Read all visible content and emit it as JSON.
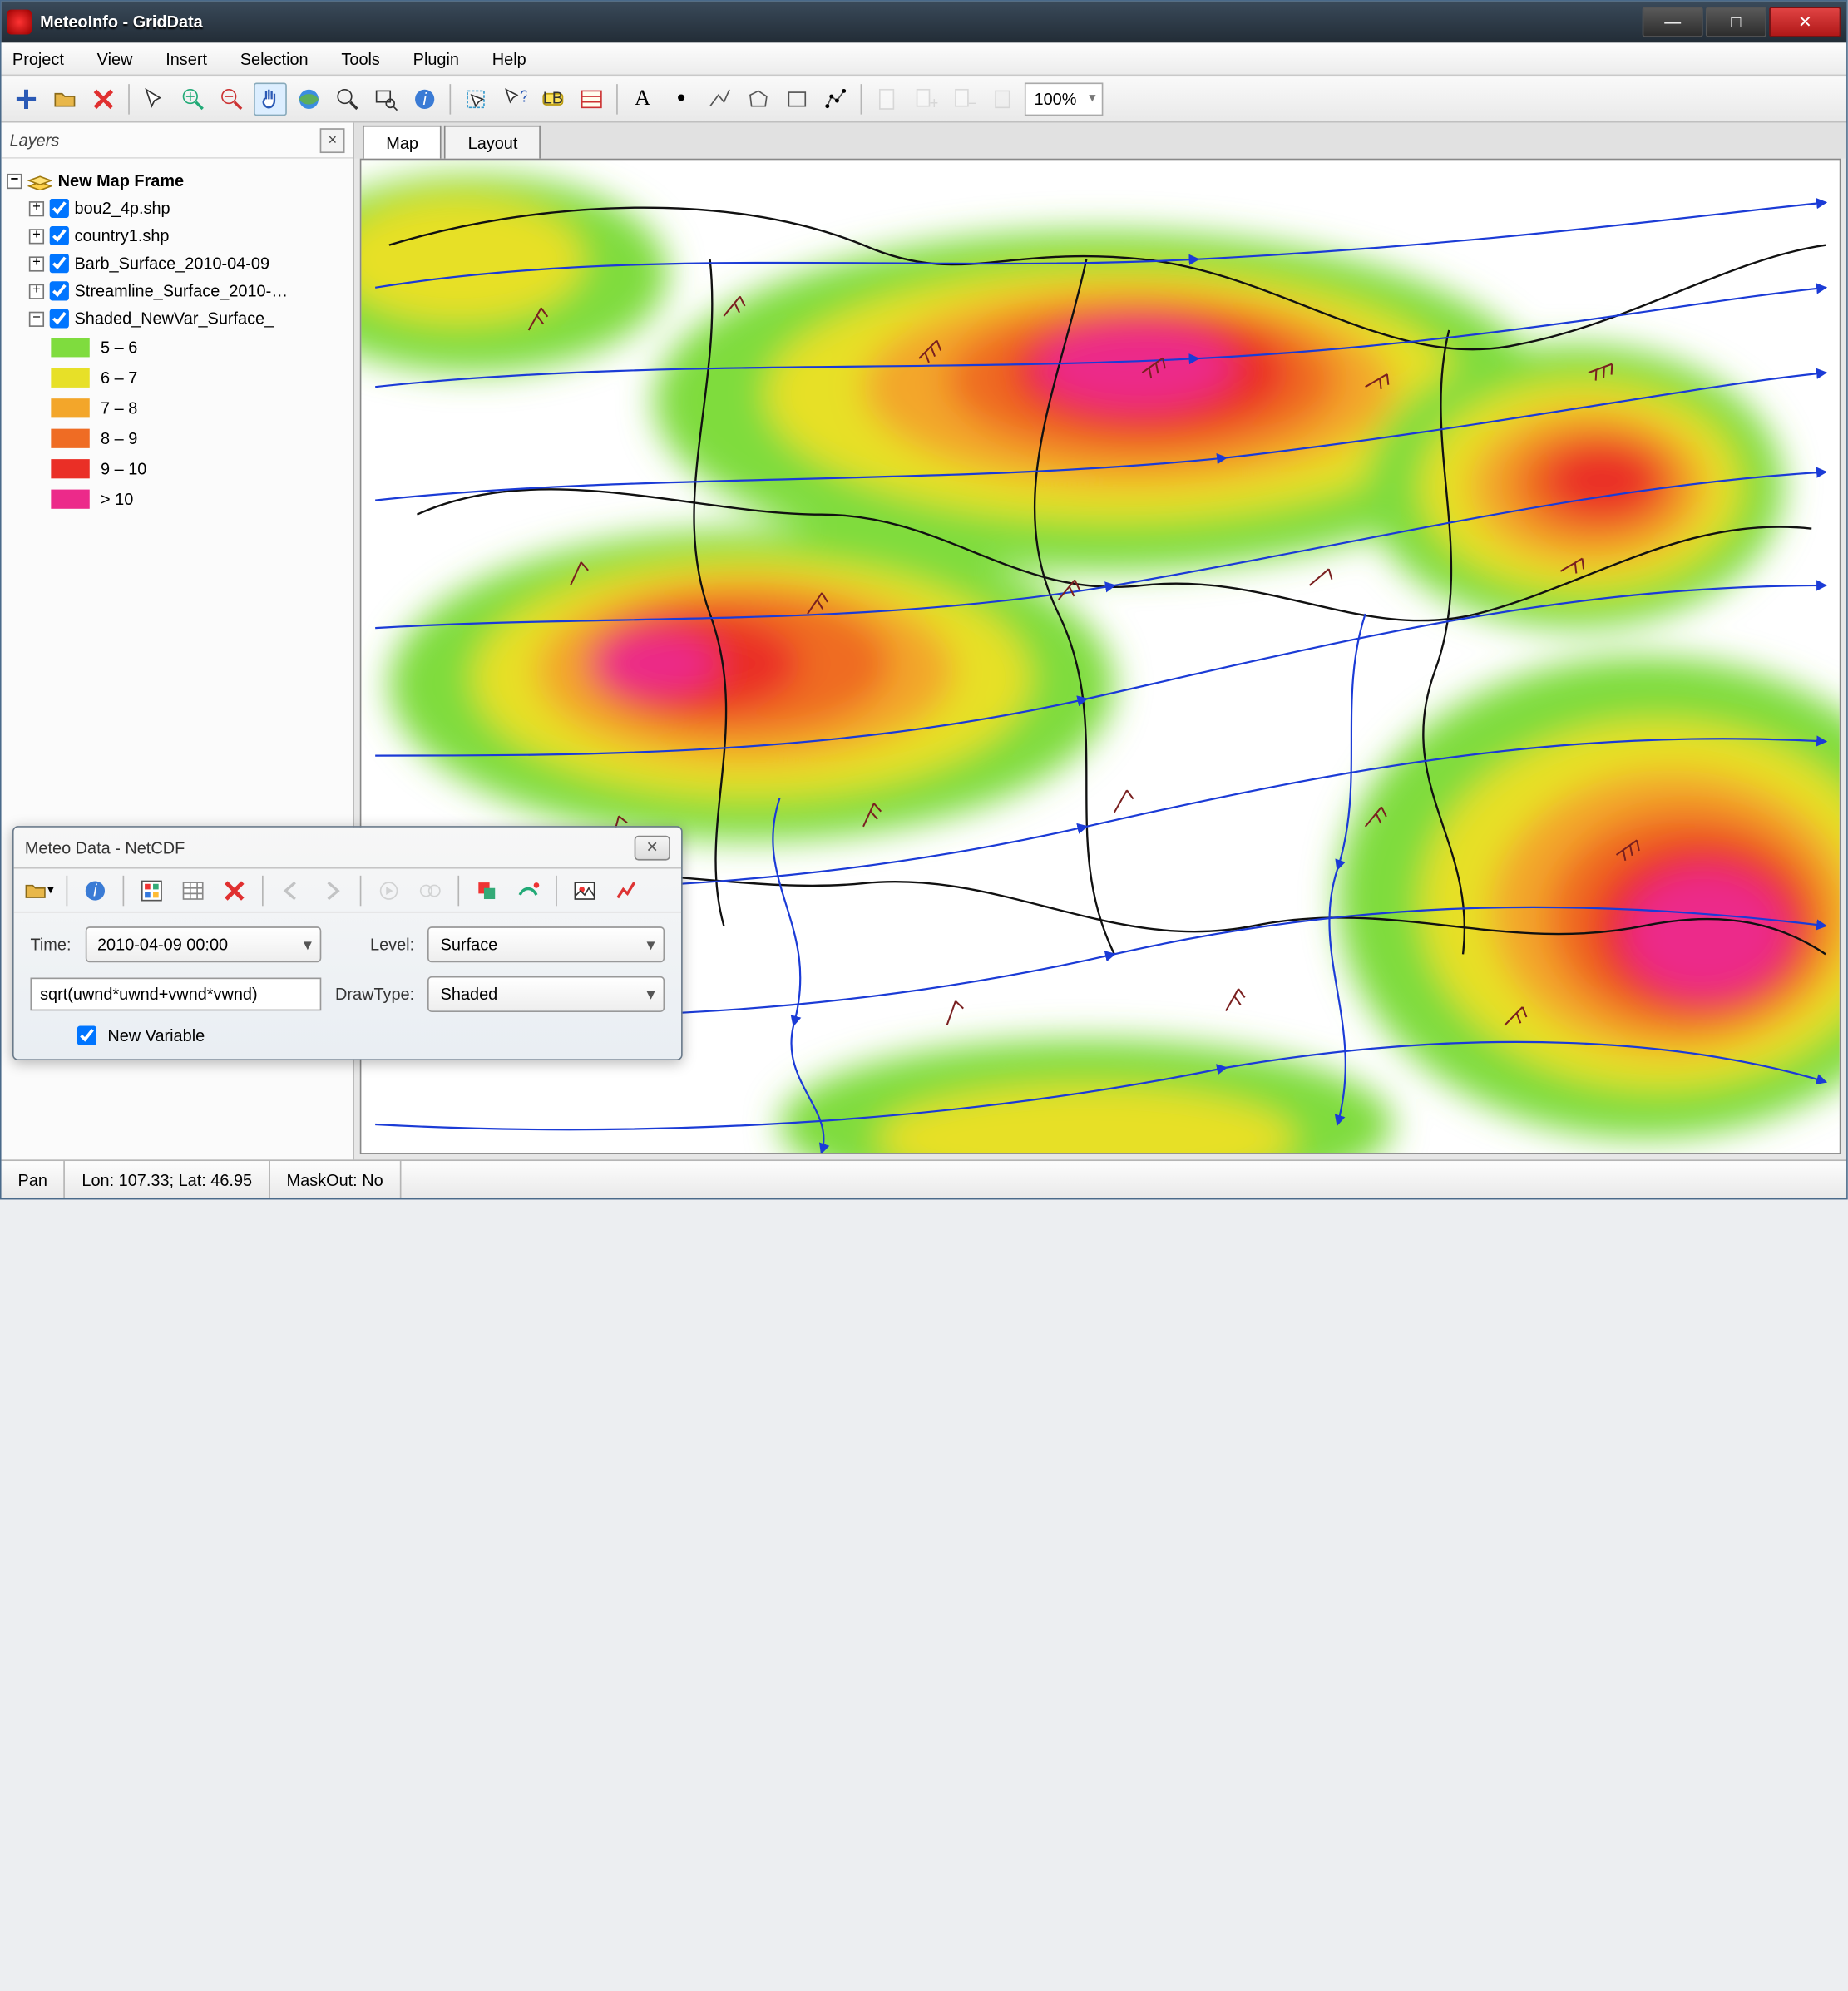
{
  "window": {
    "title": "MeteoInfo - GridData"
  },
  "menubar": [
    "Project",
    "View",
    "Insert",
    "Selection",
    "Tools",
    "Plugin",
    "Help"
  ],
  "toolbar": {
    "zoom": "100%"
  },
  "sidebar": {
    "title": "Layers",
    "frame_label": "New Map Frame",
    "layers": [
      "bou2_4p.shp",
      "country1.shp",
      "Barb_Surface_2010-04-09",
      "Streamline_Surface_2010-…",
      "Shaded_NewVar_Surface_"
    ],
    "legend": [
      {
        "color": "#7fdc3e",
        "label": "5 – 6"
      },
      {
        "color": "#e7e028",
        "label": "6 – 7"
      },
      {
        "color": "#f3a62a",
        "label": "7 – 8"
      },
      {
        "color": "#ef6c24",
        "label": "8 – 9"
      },
      {
        "color": "#ea2f26",
        "label": "9 – 10"
      },
      {
        "color": "#ec2a8a",
        "label": "> 10"
      }
    ]
  },
  "tabs": {
    "map": "Map",
    "layout": "Layout"
  },
  "dialog": {
    "title": "Meteo Data - NetCDF",
    "time_label": "Time:",
    "time_value": "2010-04-09 00:00",
    "level_label": "Level:",
    "level_value": "Surface",
    "formula": "sqrt(uwnd*uwnd+vwnd*vwnd)",
    "drawtype_label": "DrawType:",
    "drawtype_value": "Shaded",
    "newvar_label": "New Variable"
  },
  "status": {
    "tool": "Pan",
    "coords": "Lon: 107.33; Lat: 46.95",
    "mask": "MaskOut: No"
  }
}
